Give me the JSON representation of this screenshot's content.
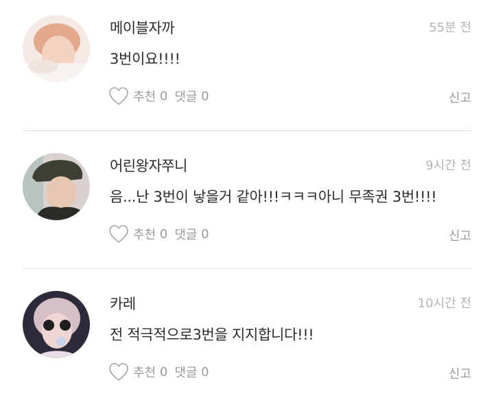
{
  "comments": [
    {
      "username": "메이블자까",
      "time": "55분 전",
      "text": "3번이요!!!!",
      "like_label": "추천",
      "like_count": "0",
      "reply_label": "댓글",
      "reply_count": "0",
      "report_label": "신고",
      "avatar_icon": "user-photo-avatar"
    },
    {
      "username": "어린왕자쭈니",
      "time": "9시간 전",
      "text": "음...난 3번이 낳을거 같아!!!ㅋㅋㅋ아니 무족권 3번!!!!",
      "like_label": "추천",
      "like_count": "0",
      "reply_label": "댓글",
      "reply_count": "0",
      "report_label": "신고",
      "avatar_icon": "user-photo-avatar"
    },
    {
      "username": "카레",
      "time": "10시간 전",
      "text": "전 적극적으로3번을 지지합니다!!!",
      "like_label": "추천",
      "like_count": "0",
      "reply_label": "댓글",
      "reply_count": "0",
      "report_label": "신고",
      "avatar_icon": "user-photo-avatar"
    }
  ],
  "colors": {
    "text": "#2b2b2b",
    "muted": "#9a9a9a",
    "time": "#b3b3b3",
    "divider": "#dedede"
  }
}
